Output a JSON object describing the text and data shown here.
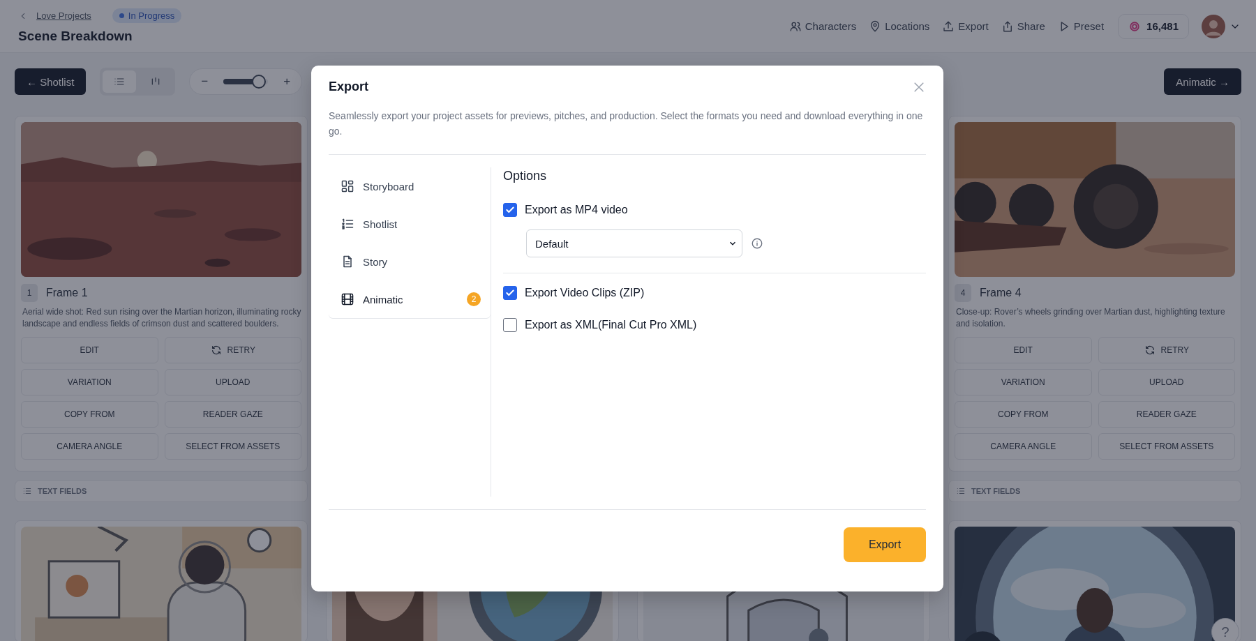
{
  "header": {
    "back_link": "Love Projects",
    "status": "In Progress",
    "title": "Scene Breakdown",
    "nav": [
      {
        "label": "Characters",
        "kind": "people"
      },
      {
        "label": "Locations",
        "kind": "pin"
      },
      {
        "label": "Export",
        "kind": "upload"
      },
      {
        "label": "Share",
        "kind": "share"
      },
      {
        "label": "Preset",
        "kind": "play"
      }
    ],
    "credits": "16,481"
  },
  "toolbar": {
    "back_button": "← Shotlist",
    "view_modes": [
      {
        "kind": "list",
        "selected": true
      },
      {
        "kind": "columns",
        "selected": false
      }
    ],
    "zoom": {
      "minus": "−",
      "plus": "+",
      "level": 0.8
    },
    "next_button": "Animatic →"
  },
  "frames": [
    {
      "number": "1",
      "title": "Frame 1",
      "description": "Aerial wide shot: Red sun rising over the Martian horizon, illuminating rocky landscape and endless fields of crimson dust and scattered boulders.",
      "actions": [
        {
          "label": "EDIT",
          "kind": "plain"
        },
        {
          "label": "RETRY",
          "kind": "retry"
        },
        {
          "label": "VARIATION",
          "kind": "plain"
        },
        {
          "label": "UPLOAD",
          "kind": "plain"
        },
        {
          "label": "COPY FROM",
          "kind": "plain"
        },
        {
          "label": "READER GAZE",
          "kind": "plain"
        },
        {
          "label": "CAMERA ANGLE",
          "kind": "plain"
        },
        {
          "label": "SELECT FROM ASSETS",
          "kind": "plain"
        }
      ],
      "text_fields": "TEXT FIELDS"
    },
    {
      "number": "4",
      "title": "Frame 4",
      "description": "Close-up: Rover’s wheels grinding over Martian dust, highlighting texture and isolation.",
      "actions": [
        {
          "label": "EDIT",
          "kind": "plain"
        },
        {
          "label": "RETRY",
          "kind": "retry"
        },
        {
          "label": "VARIATION",
          "kind": "plain"
        },
        {
          "label": "UPLOAD",
          "kind": "plain"
        },
        {
          "label": "COPY FROM",
          "kind": "plain"
        },
        {
          "label": "READER GAZE",
          "kind": "plain"
        },
        {
          "label": "CAMERA ANGLE",
          "kind": "plain"
        },
        {
          "label": "SELECT FROM ASSETS",
          "kind": "plain"
        }
      ],
      "text_fields": "TEXT FIELDS"
    }
  ],
  "help": "?",
  "modal": {
    "title": "Export",
    "description": "Seamlessly export your project assets for previews, pitches, and production. Select the formats you need and download everything in one go.",
    "sections": [
      {
        "label": "Storyboard",
        "kind": "storyboard",
        "selected": false
      },
      {
        "label": "Shotlist",
        "kind": "shotlist",
        "selected": false
      },
      {
        "label": "Story",
        "kind": "story",
        "selected": false
      },
      {
        "label": "Animatic",
        "kind": "animatic",
        "selected": true,
        "badge": "2"
      }
    ],
    "options_title": "Options",
    "option_groups": [
      [
        {
          "kind": "checkbox",
          "label": "Export as MP4 video",
          "checked": true
        },
        {
          "kind": "select",
          "value": "Default"
        }
      ],
      [
        {
          "kind": "checkbox",
          "label": "Export Video Clips (ZIP)",
          "checked": true
        },
        {
          "kind": "checkbox",
          "label": "Export as XML(Final Cut Pro XML)",
          "checked": false
        }
      ]
    ],
    "export_button": "Export"
  }
}
